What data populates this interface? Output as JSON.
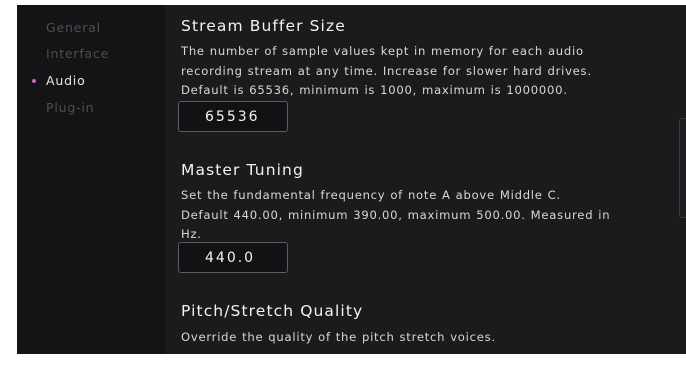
{
  "sidebar": {
    "items": [
      {
        "label": "General"
      },
      {
        "label": "Interface"
      },
      {
        "label": "Audio"
      },
      {
        "label": "Plug-in"
      }
    ],
    "accent_color": "#c968b9"
  },
  "sections": {
    "buffer": {
      "title": "Stream Buffer Size",
      "desc_lines": [
        "The number of sample values kept in memory for each audio",
        "recording stream at any time. Increase for slower hard drives.",
        "Default is 65536, minimum is 1000, maximum is 1000000."
      ],
      "value": "65536"
    },
    "tuning": {
      "title": "Master Tuning",
      "desc_lines": [
        "Set the fundamental frequency of note A above Middle C.",
        "Default 440.00, minimum 390.00, maximum 500.00. Measured in",
        "Hz."
      ],
      "value": "440.0"
    },
    "pitch": {
      "title": "Pitch/Stretch Quality",
      "desc_lines": [
        "Override the quality of the pitch stretch voices."
      ]
    }
  }
}
